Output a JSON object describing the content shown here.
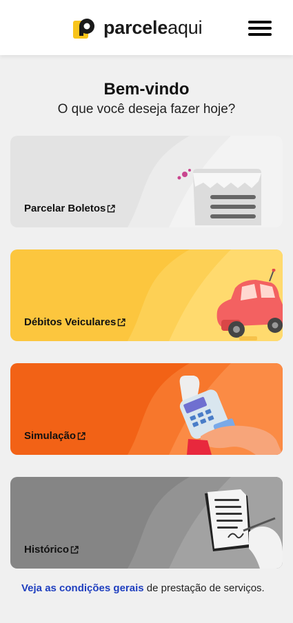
{
  "header": {
    "logo_bold": "parcele",
    "logo_light": "aqui",
    "menu_icon": "hamburger-menu-icon"
  },
  "welcome": {
    "title": "Bem-vindo",
    "subtitle": "O que você deseja fazer hoje?"
  },
  "cards": [
    {
      "label": "Parcelar Boletos",
      "icon": "receipt-icon",
      "color": "#e4e4e4",
      "accent": "#ececec"
    },
    {
      "label": "Débitos Veiculares",
      "icon": "car-icon",
      "color": "#fdc843",
      "accent": "#ffd86a"
    },
    {
      "label": "Simulação",
      "icon": "card-machine-icon",
      "color": "#f26a1b",
      "accent": "#fb8a45"
    },
    {
      "label": "Histórico",
      "icon": "document-sign-icon",
      "color": "#8a8a8a",
      "accent": "#a3a3a3"
    }
  ],
  "footer": {
    "link_text": "Veja as condições gerais",
    "rest_text": " de prestação de serviços."
  },
  "colors": {
    "brand_yellow": "#f8c41c",
    "link_blue": "#1f3fbf"
  }
}
